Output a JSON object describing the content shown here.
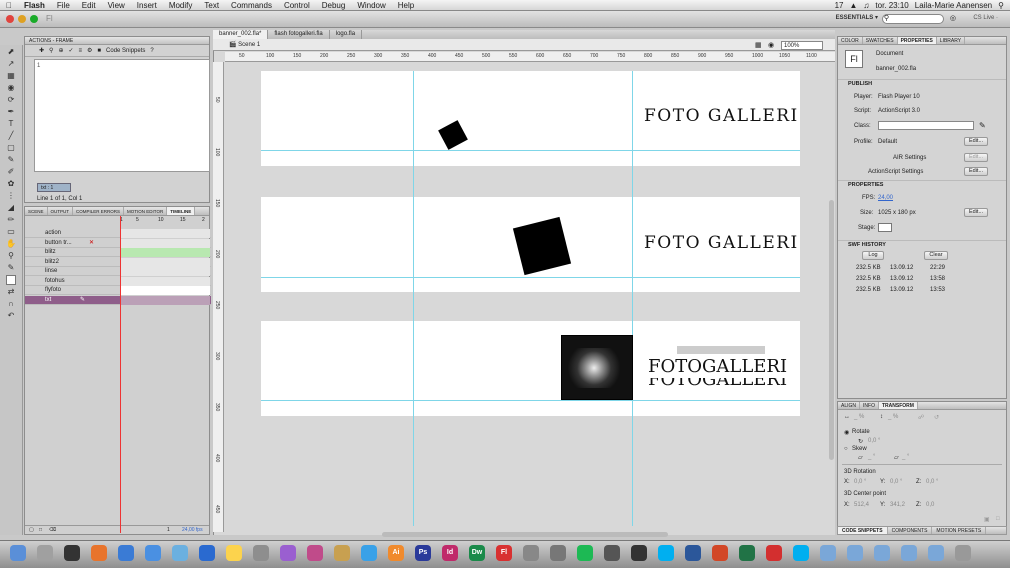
{
  "menubar": {
    "apple": "",
    "app": "Flash",
    "items": [
      "File",
      "Edit",
      "View",
      "Insert",
      "Modify",
      "Text",
      "Commands",
      "Control",
      "Debug",
      "Window",
      "Help"
    ],
    "status": {
      "badge": "17",
      "time": "tor. 23:10",
      "user": "Laila-Marie Aanensen"
    }
  },
  "apptoolbar": {
    "workspace": "ESSENTIALS ▾",
    "search_placeholder": "",
    "cs_live": "CS Live ·"
  },
  "actions_panel": {
    "tab": "ACTIONS - FRAME",
    "code_snippets": "Code Snippets",
    "line_number": "1",
    "pinned": "txt : 1",
    "status": "Line 1 of 1, Col 1"
  },
  "timeline": {
    "tabs": [
      "SCENE",
      "OUTPUT",
      "COMPILER ERRORS",
      "MOTION EDITOR",
      "TIMELINE"
    ],
    "frame_numbers": [
      "1",
      "5",
      "10",
      "15",
      "2"
    ],
    "layers": [
      "action",
      "button tr...",
      "blitz",
      "blitz2",
      "linse",
      "fotohus",
      "flyfoto",
      "txt"
    ],
    "frame_label": "1",
    "fps": "24,00 fps"
  },
  "stage": {
    "doc_tabs": [
      "banner_002.fla*",
      "flash fotogalleri.fla",
      "logo.fla"
    ],
    "scene": "Scene 1",
    "zoom": "100%",
    "ruler_top": [
      "50",
      "100",
      "150",
      "200",
      "250",
      "300",
      "350",
      "400",
      "450",
      "500",
      "550",
      "600",
      "650",
      "700",
      "750",
      "800",
      "850",
      "900",
      "950",
      "1000",
      "1050",
      "1100"
    ],
    "ruler_left": [
      "50",
      "100",
      "150",
      "200",
      "250",
      "300",
      "350",
      "400",
      "450"
    ],
    "frame1_title": "FOTO GALLERI",
    "frame2_title": "FOTO GALLERI",
    "frame3_title": "FOTOGALLERI",
    "frame3_title_ghost": "FOTOGALLERI"
  },
  "properties": {
    "tabs": [
      "COLOR",
      "SWATCHES",
      "PROPERTIES",
      "LIBRARY"
    ],
    "doc_icon": "Fl",
    "doc_type": "Document",
    "doc_name": "banner_002.fla",
    "publish_header": "PUBLISH",
    "player_label": "Player:",
    "player_value": "Flash Player 10",
    "script_label": "Script:",
    "script_value": "ActionScript 3.0",
    "class_label": "Class:",
    "profile_label": "Profile:",
    "profile_value": "Default",
    "edit": "Edit...",
    "air_settings": "AIR Settings",
    "as_settings": "ActionScript Settings",
    "properties_header": "PROPERTIES",
    "fps_label": "FPS:",
    "fps_value": "24,00",
    "size_label": "Size:",
    "size_value": "1025 x 180 px",
    "stage_label": "Stage:",
    "swf_history_header": "SWF HISTORY",
    "log_button": "Log",
    "clear_button": "Clear",
    "history": [
      {
        "size": "232.5 KB",
        "date": "13.09.12",
        "time": "22:29"
      },
      {
        "size": "232.5 KB",
        "date": "13.09.12",
        "time": "13:58"
      },
      {
        "size": "232.5 KB",
        "date": "13.09.12",
        "time": "13:53"
      }
    ]
  },
  "transform": {
    "tabs": [
      "ALIGN",
      "INFO",
      "TRANSFORM"
    ],
    "width_pct": "_ %",
    "height_pct": "_ %",
    "rotate": "Rotate",
    "rotate_val": "0,0 °",
    "skew": "Skew",
    "skew_h": "_ °",
    "skew_v": "_ °",
    "rot3d": "3D Rotation",
    "rx": "X:",
    "rx_v": "0,0 °",
    "ry": "Y:",
    "ry_v": "0,0 °",
    "rz": "Z:",
    "rz_v": "0,0 °",
    "center3d": "3D Center point",
    "cx": "X:",
    "cx_v": "512,4",
    "cy": "Y:",
    "cy_v": "341,2",
    "cz": "Z:",
    "cz_v": "0,0"
  },
  "bottom_tabs": [
    "CODE SNIPPETS",
    "COMPONENTS",
    "MOTION PRESETS"
  ],
  "dock": {
    "items": [
      "Finder",
      "Launchpad",
      "Mission Control",
      "Firefox",
      "Chrome",
      "Safari",
      "Mail",
      "Calendar",
      "Notes",
      "Messages",
      "FaceTime",
      "iTunes",
      "iPhoto",
      "App Store",
      "Ai",
      "Ps",
      "Id",
      "Dw",
      "Fl",
      "System Prefs",
      "Preview",
      "Spotify",
      "Photo Booth",
      "Terminal",
      "Skype",
      "Word",
      "PowerPoint",
      "Excel",
      "Acrobat",
      "Skype2",
      "Folder",
      "Folder",
      "Folder",
      "Folder",
      "Folder",
      "Trash"
    ]
  }
}
